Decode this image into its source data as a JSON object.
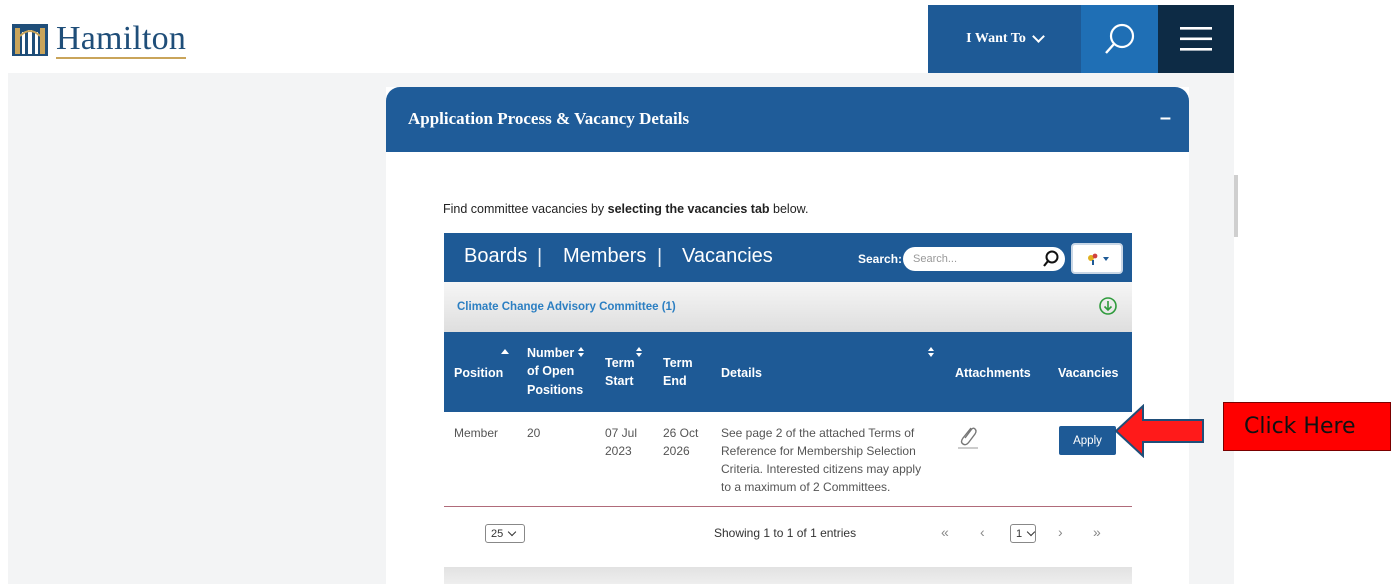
{
  "header": {
    "logo_text": "Hamilton",
    "i_want_to_label": "I Want To",
    "search_icon": "search-icon",
    "menu_icon": "hamburger-menu-icon"
  },
  "panel": {
    "title": "Application Process & Vacancy Details",
    "collapse_symbol": "–",
    "intro_prefix": "Find committee vacancies by ",
    "intro_bold": "selecting the vacancies tab",
    "intro_suffix": " below."
  },
  "widget": {
    "tabs": [
      "Boards",
      "Members",
      "Vacancies"
    ],
    "separator": "|",
    "search_label": "Search:",
    "search_placeholder": "Search...",
    "group_label": "Climate Change Advisory Committee (1)",
    "columns": {
      "position": "Position",
      "open_positions": [
        "Number",
        "of Open",
        "Positions"
      ],
      "term_start": [
        "Term",
        "Start"
      ],
      "term_end": [
        "Term",
        "End"
      ],
      "details": "Details",
      "attachments": "Attachments",
      "vacancies": "Vacancies"
    },
    "rows": [
      {
        "position": "Member",
        "open_positions": "20",
        "term_start": [
          "07 Jul",
          "2023"
        ],
        "term_end": [
          "26 Oct",
          "2026"
        ],
        "details": [
          "See page 2 of the attached Terms of",
          "Reference for Membership Selection",
          "Criteria. Interested citizens may apply",
          "to a maximum of 2 Committees."
        ],
        "attachment_icon": "paperclip-icon",
        "action_label": "Apply"
      }
    ],
    "page_size": "25",
    "showing_text": "Showing 1 to 1 of 1 entries",
    "current_page": "1",
    "pager": {
      "first": "«",
      "prev": "‹",
      "next": "›",
      "last": "»"
    }
  },
  "callout": {
    "label": "Click Here",
    "color": "#ff0000"
  },
  "colors": {
    "brand_blue": "#1e5a96",
    "dark_navy": "#0d2b45",
    "link_blue": "#2c7fc2"
  }
}
